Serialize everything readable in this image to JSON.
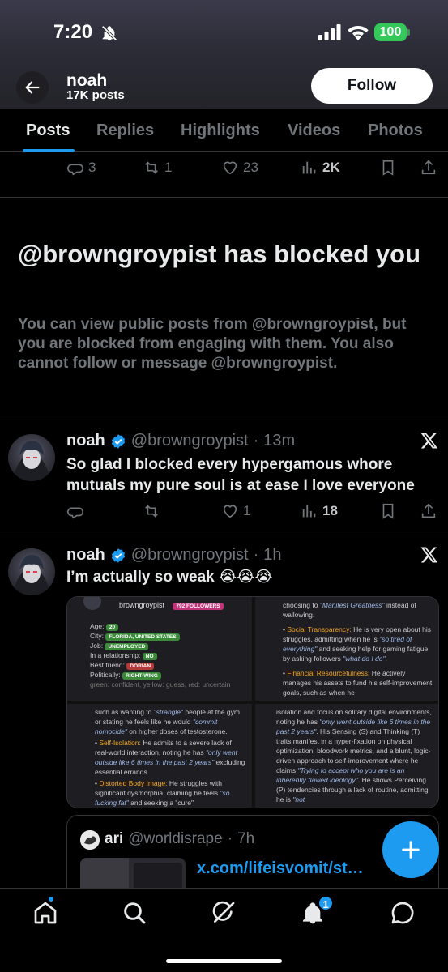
{
  "status_bar": {
    "time": "7:20",
    "battery": "100"
  },
  "header": {
    "name": "noah",
    "posts": "17K posts",
    "follow_label": "Follow"
  },
  "tabs": [
    "Posts",
    "Replies",
    "Highlights",
    "Videos",
    "Photos"
  ],
  "top_actions": {
    "replies": "3",
    "reposts": "1",
    "likes": "23",
    "views": "2K"
  },
  "blocked": {
    "title": "@browngroypist has blocked you",
    "description": "You can view public posts from @browngroypist, but you are blocked from engaging with them. You also cannot follow or message @browngroypist."
  },
  "tweets": [
    {
      "name": "noah",
      "handle": "@browngroypist",
      "time": "13m",
      "text": "So glad I blocked every hypergamous whore mutuals my pure soul is at ease I love everyone",
      "actions": {
        "replies": "",
        "reposts": "",
        "likes": "1",
        "views": "18"
      }
    },
    {
      "name": "noah",
      "handle": "@browngroypist",
      "time": "1h",
      "text": "I’m actually so weak 😭😭😭",
      "media": {
        "p1": {
          "username": "browngroypist",
          "followers": "792 FOLLOWERS",
          "age_label": "Age:",
          "age": "20",
          "city_label": "City:",
          "city": "FLORIDA, UNITED STATES",
          "job_label": "Job:",
          "job": "UNEMPLOYED",
          "rel_label": "In a relationship:",
          "rel": "NO",
          "bf_label": "Best friend:",
          "bf": "DORIAN",
          "pol_label": "Politically:",
          "pol": "RIGHT-WING",
          "legend": "green: confident, yellow: guess, red: uncertain"
        },
        "p2": {
          "l1": "choosing to ",
          "l1b": "\"Manifest Greatness\"",
          "l1c": " instead of wallowing.",
          "h1": "Social Transparency:",
          "t1": " He is very open about his struggles, admitting when he is ",
          "q1": "\"so tired of everything\"",
          "t1b": " and seeking help for gaming fatigue by asking followers ",
          "q1b": "\"what do I do\"",
          "h2": "Financial Resourcefulness:",
          "t2": " He actively manages his assets to fund his self-improvement goals, such as when he"
        },
        "p3": {
          "l1": "such as wanting to ",
          "q1": "\"strangle\"",
          "l1b": " people at the gym or stating he feels like he would ",
          "q1b": "\"commit homocide\"",
          "l1c": " on higher doses of testosterone.",
          "h1": "Self-Isolation:",
          "t1": " He admits to a severe lack of real-world interaction, noting he has ",
          "q2": "\"only went outside like 6 times in the past 2 years\"",
          "t1b": " excluding essential errands.",
          "h2": "Distorted Body Image:",
          "t2": " He struggles with significant dysmorphia, claiming he feels ",
          "q3": "\"so fucking fat\"",
          "t2b": " and seeking a \"cure\""
        },
        "p4": {
          "t1": "isolation and focus on solitary digital environments, noting he has ",
          "q1": "\"only went outside like 6 times in the past 2 years\"",
          "t1b": ". His Sensing (S) and Thinking (T) traits manifest in a hyper-fixation on physical optimization, bloodwork metrics, and a blunt, logic-driven approach to self-improvement where he claims ",
          "q2": "\"Trying to accept who you are is an inherently flawed ideology\"",
          "t1c": ". He shows Perceiving (P) tendencies through a lack of routine, admitting he is ",
          "q3": "\"not"
        }
      },
      "quote": {
        "name": "ari",
        "handle": "@worldisrape",
        "time": "7h",
        "link": "x.com/lifeisvomit/st…"
      }
    }
  ],
  "nav": {
    "notifications_badge": "1"
  },
  "colors": {
    "accent": "#1d9bf0",
    "muted": "#71767b",
    "text": "#e7e9ea",
    "battery": "#34c759",
    "highlight": "#f5a623"
  },
  "icons": [
    "back-arrow-icon",
    "bell-off-icon",
    "signal-icon",
    "wifi-icon",
    "reply-icon",
    "repost-icon",
    "like-icon",
    "views-icon",
    "bookmark-icon",
    "share-icon",
    "verified-icon",
    "x-logo-icon",
    "plus-icon",
    "home-icon",
    "search-icon",
    "grok-icon",
    "notifications-icon",
    "messages-icon"
  ]
}
